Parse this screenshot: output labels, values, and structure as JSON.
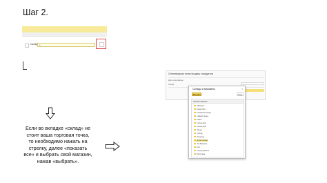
{
  "heading": "Шаг 2.",
  "left_form": {
    "field_label": "Склад",
    "field_value": "1"
  },
  "instruction": "Если во вкладке «склад» не стоит ваша торговая точка, то необходимо нажать на стрелку, далее «показать все» и выбрать свой магазин, нажав «выбрать».",
  "icons": [
    "arrow-down-icon",
    "arrow-right-icon",
    "folder-icon",
    "close-icon"
  ],
  "colors": {
    "highlight_yellow": "#f7eb9a",
    "red_frame": "#d84a4a",
    "button_yellow": "#f2d54f"
  },
  "window": {
    "title": "Оптимизация точки продаж: продуктов",
    "row1": "Дата и магазины",
    "row2": "Склад"
  },
  "dialog": {
    "title": "Склады и магазины",
    "close": "×",
    "select_button": "Выбрать",
    "more_button": "Еще",
    "column_header": "Наименование",
    "items": [
      "Магазин",
      "Киоск №1",
      "Основной склад",
      "Новый склад",
      "Кафе",
      "Склад №2",
      "Склад №3",
      "Точка",
      "Склад",
      "Розница",
      "Д №1 Склад",
      "ТЦ Магазин",
      "Опт",
      "Склад ЗАКУП",
      "Ресторан"
    ],
    "selected_index": 10
  }
}
